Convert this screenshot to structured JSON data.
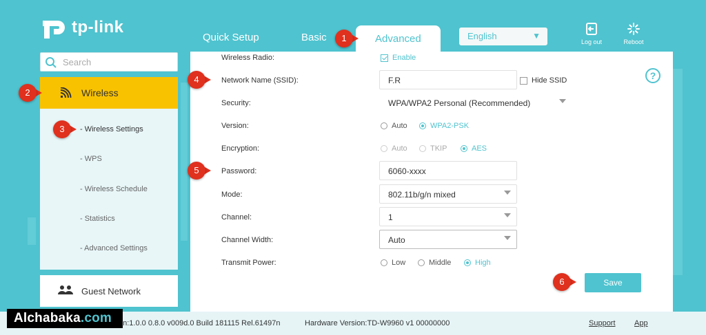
{
  "brand": {
    "logo_text": "tp-link"
  },
  "nav": {
    "tabs": [
      {
        "label": "Quick Setup"
      },
      {
        "label": "Basic"
      },
      {
        "label": "Advanced"
      }
    ],
    "language": "English",
    "logout_label": "Log out",
    "reboot_label": "Reboot"
  },
  "sidebar": {
    "search_placeholder": "Search",
    "section": "Wireless",
    "items": [
      {
        "label": "- Wireless Settings"
      },
      {
        "label": "- WPS"
      },
      {
        "label": "- Wireless Schedule"
      },
      {
        "label": "- Statistics"
      },
      {
        "label": "- Advanced Settings"
      }
    ],
    "guest_network": "Guest Network"
  },
  "form": {
    "wireless_radio": {
      "label": "Wireless Radio:",
      "option": "Enable"
    },
    "ssid": {
      "label": "Network Name (SSID):",
      "value": "F.R",
      "hide_label": "Hide SSID"
    },
    "security": {
      "label": "Security:",
      "value": "WPA/WPA2 Personal (Recommended)"
    },
    "version": {
      "label": "Version:",
      "opt_auto": "Auto",
      "opt_wpa2": "WPA2-PSK"
    },
    "encryption": {
      "label": "Encryption:",
      "opt_auto": "Auto",
      "opt_tkip": "TKIP",
      "opt_aes": "AES"
    },
    "password": {
      "label": "Password:",
      "value": "6060-xxxx"
    },
    "mode": {
      "label": "Mode:",
      "value": "802.11b/g/n mixed"
    },
    "channel": {
      "label": "Channel:",
      "value": "1"
    },
    "channel_width": {
      "label": "Channel Width:",
      "value": "Auto"
    },
    "transmit_power": {
      "label": "Transmit Power:",
      "opt_low": "Low",
      "opt_middle": "Middle",
      "opt_high": "High"
    },
    "help_glyph": "?",
    "save_label": "Save"
  },
  "footer": {
    "firmware": "on:1.0.0 0.8.0 v009d.0 Build 181115 Rel.61497n",
    "hardware": "Hardware Version:TD-W9960 v1 00000000",
    "support": "Support",
    "app": "App"
  },
  "watermark": {
    "name": "Alchabaka",
    "domain": ".com"
  },
  "markers": [
    "1",
    "2",
    "3",
    "4",
    "5",
    "6"
  ],
  "colors": {
    "accent": "#4fc3cf",
    "highlight": "#f9c200",
    "marker": "#e0301e"
  }
}
